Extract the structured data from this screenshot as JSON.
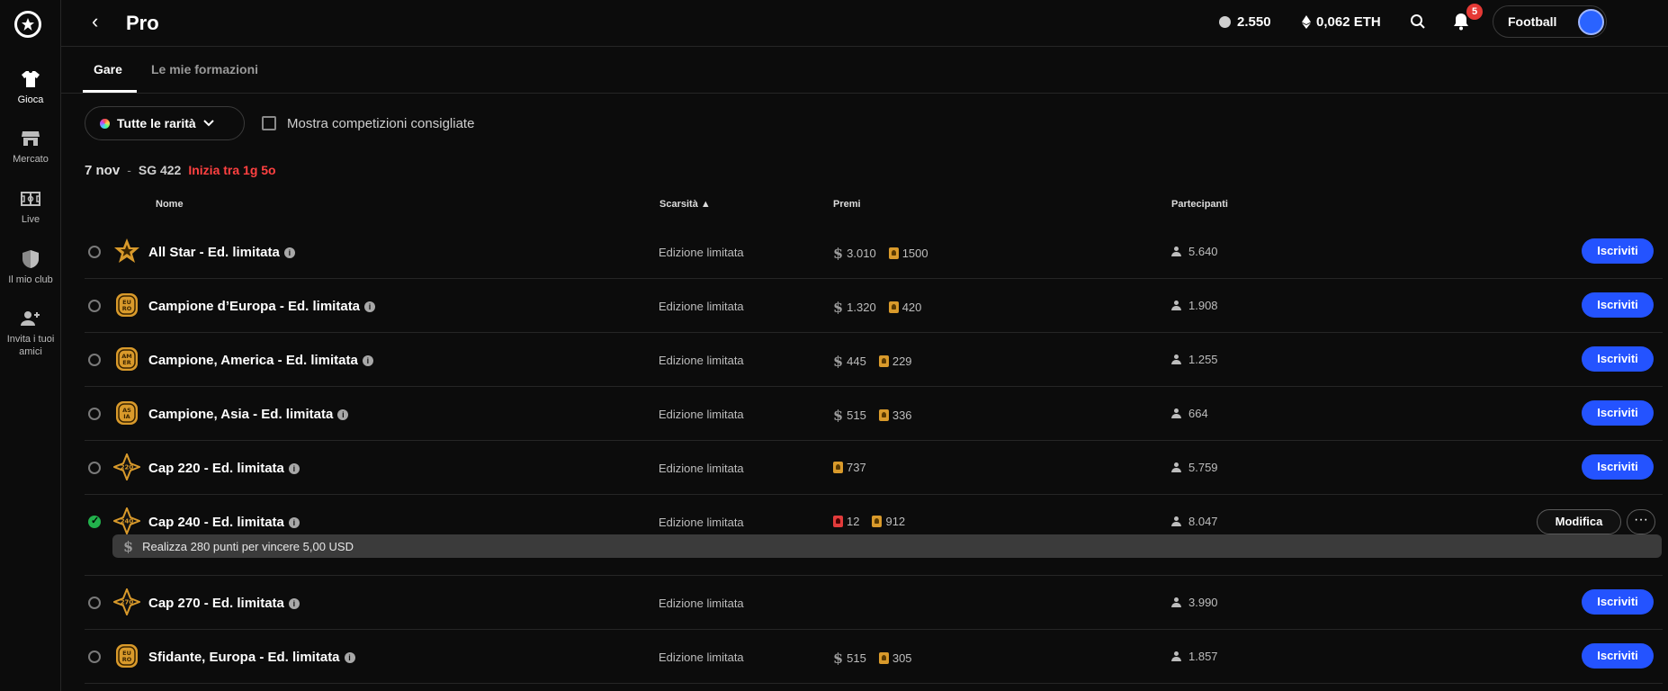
{
  "sidebar": {
    "items": [
      {
        "label": "Gioca",
        "icon": "jersey-icon",
        "active": true
      },
      {
        "label": "Mercato",
        "icon": "market-icon",
        "active": false
      },
      {
        "label": "Live",
        "icon": "field-icon",
        "active": false
      },
      {
        "label": "Il mio club",
        "icon": "shield-icon",
        "active": false
      },
      {
        "label": "Invita i tuoi amici",
        "icon": "add-user-icon",
        "active": false
      }
    ]
  },
  "header": {
    "back_label": "‹",
    "title": "Pro",
    "coins": "2.550",
    "eth": "0,062 ETH",
    "notifications_count": "5",
    "sport": "Football"
  },
  "tabs": [
    {
      "label": "Gare",
      "active": true
    },
    {
      "label": "Le mie formazioni",
      "active": false
    }
  ],
  "filters": {
    "rarity_label": "Tutte le rarità",
    "recommended_label": "Mostra competizioni consigliate",
    "recommended_checked": false
  },
  "gameweek": {
    "date": "7 nov",
    "separator": "-",
    "id": "SG 422",
    "starts": "Inizia tra 1g 5o"
  },
  "table": {
    "headers": {
      "name": "Nome",
      "rarity": "Scarsità ▲",
      "prizes": "Premi",
      "participants": "Partecipanti"
    },
    "join_label": "Iscriviti",
    "edit_label": "Modifica",
    "more_label": "···",
    "rows": [
      {
        "name": "All Star - Ed. limitata",
        "icon": "all-star",
        "rarity": "Edizione limitata",
        "cash": "3.010",
        "red_cards": "",
        "cards": "1500",
        "participants": "5.640",
        "joined": false
      },
      {
        "name": "Campione d’Europa - Ed. limitata",
        "icon": "euro",
        "rarity": "Edizione limitata",
        "cash": "1.320",
        "red_cards": "",
        "cards": "420",
        "participants": "1.908",
        "joined": false
      },
      {
        "name": "Campione, America - Ed. limitata",
        "icon": "america",
        "rarity": "Edizione limitata",
        "cash": "445",
        "red_cards": "",
        "cards": "229",
        "participants": "1.255",
        "joined": false
      },
      {
        "name": "Campione, Asia - Ed. limitata",
        "icon": "asia",
        "rarity": "Edizione limitata",
        "cash": "515",
        "red_cards": "",
        "cards": "336",
        "participants": "664",
        "joined": false
      },
      {
        "name": "Cap 220 - Ed. limitata",
        "icon": "cap220",
        "rarity": "Edizione limitata",
        "cash": "",
        "red_cards": "",
        "cards": "737",
        "participants": "5.759",
        "joined": false
      },
      {
        "name": "Cap 240 - Ed. limitata",
        "icon": "cap240",
        "rarity": "Edizione limitata",
        "cash": "",
        "red_cards": "12",
        "cards": "912",
        "participants": "8.047",
        "joined": true
      },
      {
        "name": "Cap 270 - Ed. limitata",
        "icon": "cap270",
        "rarity": "Edizione limitata",
        "cash": "",
        "red_cards": "",
        "cards": "",
        "participants": "3.990",
        "joined": false
      },
      {
        "name": "Sfidante, Europa - Ed. limitata",
        "icon": "euro-challenger",
        "rarity": "Edizione limitata",
        "cash": "515",
        "red_cards": "",
        "cards": "305",
        "participants": "1.857",
        "joined": false
      }
    ],
    "objective": {
      "dollar": "$",
      "text": "Realizza 280 punti per vincere 5,00 USD"
    }
  },
  "badge_text": {
    "euro": [
      "EU",
      "RO"
    ],
    "america": [
      "AM",
      "ER"
    ],
    "asia": [
      "AS",
      "IA"
    ],
    "cap220": "220",
    "cap240": "240",
    "cap270": "270"
  },
  "colors": {
    "accent": "#2453ff",
    "alert": "#ff4141",
    "gold": "#d99a2b",
    "success": "#22b14c"
  }
}
